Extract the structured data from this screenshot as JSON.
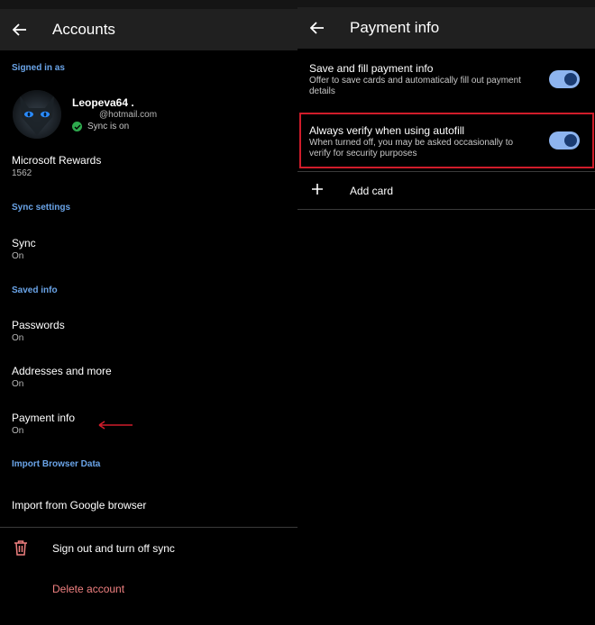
{
  "left": {
    "title": "Accounts",
    "signed_in_label": "Signed in as",
    "profile": {
      "name": "Leopeva64 .",
      "email": "@hotmail.com",
      "sync_status": "Sync is on"
    },
    "rewards": {
      "label": "Microsoft Rewards",
      "value": "1562"
    },
    "sync_settings_label": "Sync settings",
    "sync": {
      "label": "Sync",
      "value": "On"
    },
    "saved_info_label": "Saved info",
    "passwords": {
      "label": "Passwords",
      "value": "On"
    },
    "addresses": {
      "label": "Addresses and more",
      "value": "On"
    },
    "payment": {
      "label": "Payment info",
      "value": "On"
    },
    "import_label": "Import Browser Data",
    "import_google": "Import from Google browser",
    "sign_out": "Sign out and turn off sync",
    "delete_account": "Delete account"
  },
  "right": {
    "title": "Payment info",
    "save_fill": {
      "title": "Save and fill payment info",
      "desc": "Offer to save cards and automatically fill out payment details",
      "enabled": true
    },
    "always_verify": {
      "title": "Always verify when using autofill",
      "desc": "When turned off, you may be asked occasionally to verify for security purposes",
      "enabled": true
    },
    "add_card": "Add card"
  },
  "colors": {
    "section_label": "#6aa4e8",
    "toggle_track": "#8db4ef",
    "toggle_knob": "#1b3c72",
    "annotation_red": "#d01c2a",
    "delete_text": "#f08080"
  },
  "icons": [
    "back-arrow-icon",
    "check-circle-icon",
    "trash-icon",
    "plus-icon",
    "annotation-arrow-icon"
  ]
}
